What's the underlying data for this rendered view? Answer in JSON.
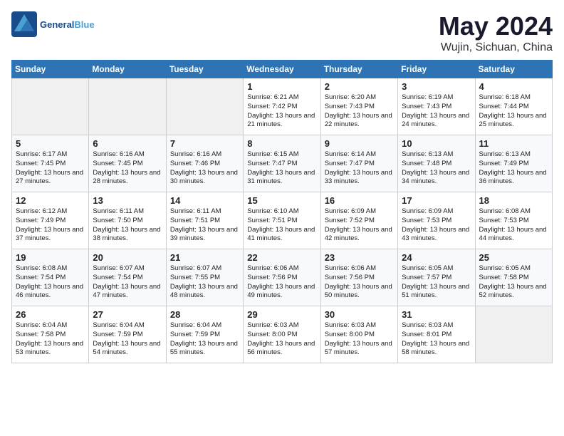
{
  "header": {
    "logo_text1": "General",
    "logo_text2": "Blue",
    "title": "May 2024",
    "subtitle": "Wujin, Sichuan, China"
  },
  "weekdays": [
    "Sunday",
    "Monday",
    "Tuesday",
    "Wednesday",
    "Thursday",
    "Friday",
    "Saturday"
  ],
  "weeks": [
    [
      {
        "day": "",
        "sunrise": "",
        "sunset": "",
        "daylight": "",
        "empty": true
      },
      {
        "day": "",
        "sunrise": "",
        "sunset": "",
        "daylight": "",
        "empty": true
      },
      {
        "day": "",
        "sunrise": "",
        "sunset": "",
        "daylight": "",
        "empty": true
      },
      {
        "day": "1",
        "sunrise": "Sunrise: 6:21 AM",
        "sunset": "Sunset: 7:42 PM",
        "daylight": "Daylight: 13 hours and 21 minutes.",
        "empty": false
      },
      {
        "day": "2",
        "sunrise": "Sunrise: 6:20 AM",
        "sunset": "Sunset: 7:43 PM",
        "daylight": "Daylight: 13 hours and 22 minutes.",
        "empty": false
      },
      {
        "day": "3",
        "sunrise": "Sunrise: 6:19 AM",
        "sunset": "Sunset: 7:43 PM",
        "daylight": "Daylight: 13 hours and 24 minutes.",
        "empty": false
      },
      {
        "day": "4",
        "sunrise": "Sunrise: 6:18 AM",
        "sunset": "Sunset: 7:44 PM",
        "daylight": "Daylight: 13 hours and 25 minutes.",
        "empty": false
      }
    ],
    [
      {
        "day": "5",
        "sunrise": "Sunrise: 6:17 AM",
        "sunset": "Sunset: 7:45 PM",
        "daylight": "Daylight: 13 hours and 27 minutes.",
        "empty": false
      },
      {
        "day": "6",
        "sunrise": "Sunrise: 6:16 AM",
        "sunset": "Sunset: 7:45 PM",
        "daylight": "Daylight: 13 hours and 28 minutes.",
        "empty": false
      },
      {
        "day": "7",
        "sunrise": "Sunrise: 6:16 AM",
        "sunset": "Sunset: 7:46 PM",
        "daylight": "Daylight: 13 hours and 30 minutes.",
        "empty": false
      },
      {
        "day": "8",
        "sunrise": "Sunrise: 6:15 AM",
        "sunset": "Sunset: 7:47 PM",
        "daylight": "Daylight: 13 hours and 31 minutes.",
        "empty": false
      },
      {
        "day": "9",
        "sunrise": "Sunrise: 6:14 AM",
        "sunset": "Sunset: 7:47 PM",
        "daylight": "Daylight: 13 hours and 33 minutes.",
        "empty": false
      },
      {
        "day": "10",
        "sunrise": "Sunrise: 6:13 AM",
        "sunset": "Sunset: 7:48 PM",
        "daylight": "Daylight: 13 hours and 34 minutes.",
        "empty": false
      },
      {
        "day": "11",
        "sunrise": "Sunrise: 6:13 AM",
        "sunset": "Sunset: 7:49 PM",
        "daylight": "Daylight: 13 hours and 36 minutes.",
        "empty": false
      }
    ],
    [
      {
        "day": "12",
        "sunrise": "Sunrise: 6:12 AM",
        "sunset": "Sunset: 7:49 PM",
        "daylight": "Daylight: 13 hours and 37 minutes.",
        "empty": false
      },
      {
        "day": "13",
        "sunrise": "Sunrise: 6:11 AM",
        "sunset": "Sunset: 7:50 PM",
        "daylight": "Daylight: 13 hours and 38 minutes.",
        "empty": false
      },
      {
        "day": "14",
        "sunrise": "Sunrise: 6:11 AM",
        "sunset": "Sunset: 7:51 PM",
        "daylight": "Daylight: 13 hours and 39 minutes.",
        "empty": false
      },
      {
        "day": "15",
        "sunrise": "Sunrise: 6:10 AM",
        "sunset": "Sunset: 7:51 PM",
        "daylight": "Daylight: 13 hours and 41 minutes.",
        "empty": false
      },
      {
        "day": "16",
        "sunrise": "Sunrise: 6:09 AM",
        "sunset": "Sunset: 7:52 PM",
        "daylight": "Daylight: 13 hours and 42 minutes.",
        "empty": false
      },
      {
        "day": "17",
        "sunrise": "Sunrise: 6:09 AM",
        "sunset": "Sunset: 7:53 PM",
        "daylight": "Daylight: 13 hours and 43 minutes.",
        "empty": false
      },
      {
        "day": "18",
        "sunrise": "Sunrise: 6:08 AM",
        "sunset": "Sunset: 7:53 PM",
        "daylight": "Daylight: 13 hours and 44 minutes.",
        "empty": false
      }
    ],
    [
      {
        "day": "19",
        "sunrise": "Sunrise: 6:08 AM",
        "sunset": "Sunset: 7:54 PM",
        "daylight": "Daylight: 13 hours and 46 minutes.",
        "empty": false
      },
      {
        "day": "20",
        "sunrise": "Sunrise: 6:07 AM",
        "sunset": "Sunset: 7:54 PM",
        "daylight": "Daylight: 13 hours and 47 minutes.",
        "empty": false
      },
      {
        "day": "21",
        "sunrise": "Sunrise: 6:07 AM",
        "sunset": "Sunset: 7:55 PM",
        "daylight": "Daylight: 13 hours and 48 minutes.",
        "empty": false
      },
      {
        "day": "22",
        "sunrise": "Sunrise: 6:06 AM",
        "sunset": "Sunset: 7:56 PM",
        "daylight": "Daylight: 13 hours and 49 minutes.",
        "empty": false
      },
      {
        "day": "23",
        "sunrise": "Sunrise: 6:06 AM",
        "sunset": "Sunset: 7:56 PM",
        "daylight": "Daylight: 13 hours and 50 minutes.",
        "empty": false
      },
      {
        "day": "24",
        "sunrise": "Sunrise: 6:05 AM",
        "sunset": "Sunset: 7:57 PM",
        "daylight": "Daylight: 13 hours and 51 minutes.",
        "empty": false
      },
      {
        "day": "25",
        "sunrise": "Sunrise: 6:05 AM",
        "sunset": "Sunset: 7:58 PM",
        "daylight": "Daylight: 13 hours and 52 minutes.",
        "empty": false
      }
    ],
    [
      {
        "day": "26",
        "sunrise": "Sunrise: 6:04 AM",
        "sunset": "Sunset: 7:58 PM",
        "daylight": "Daylight: 13 hours and 53 minutes.",
        "empty": false
      },
      {
        "day": "27",
        "sunrise": "Sunrise: 6:04 AM",
        "sunset": "Sunset: 7:59 PM",
        "daylight": "Daylight: 13 hours and 54 minutes.",
        "empty": false
      },
      {
        "day": "28",
        "sunrise": "Sunrise: 6:04 AM",
        "sunset": "Sunset: 7:59 PM",
        "daylight": "Daylight: 13 hours and 55 minutes.",
        "empty": false
      },
      {
        "day": "29",
        "sunrise": "Sunrise: 6:03 AM",
        "sunset": "Sunset: 8:00 PM",
        "daylight": "Daylight: 13 hours and 56 minutes.",
        "empty": false
      },
      {
        "day": "30",
        "sunrise": "Sunrise: 6:03 AM",
        "sunset": "Sunset: 8:00 PM",
        "daylight": "Daylight: 13 hours and 57 minutes.",
        "empty": false
      },
      {
        "day": "31",
        "sunrise": "Sunrise: 6:03 AM",
        "sunset": "Sunset: 8:01 PM",
        "daylight": "Daylight: 13 hours and 58 minutes.",
        "empty": false
      },
      {
        "day": "",
        "sunrise": "",
        "sunset": "",
        "daylight": "",
        "empty": true
      }
    ]
  ]
}
